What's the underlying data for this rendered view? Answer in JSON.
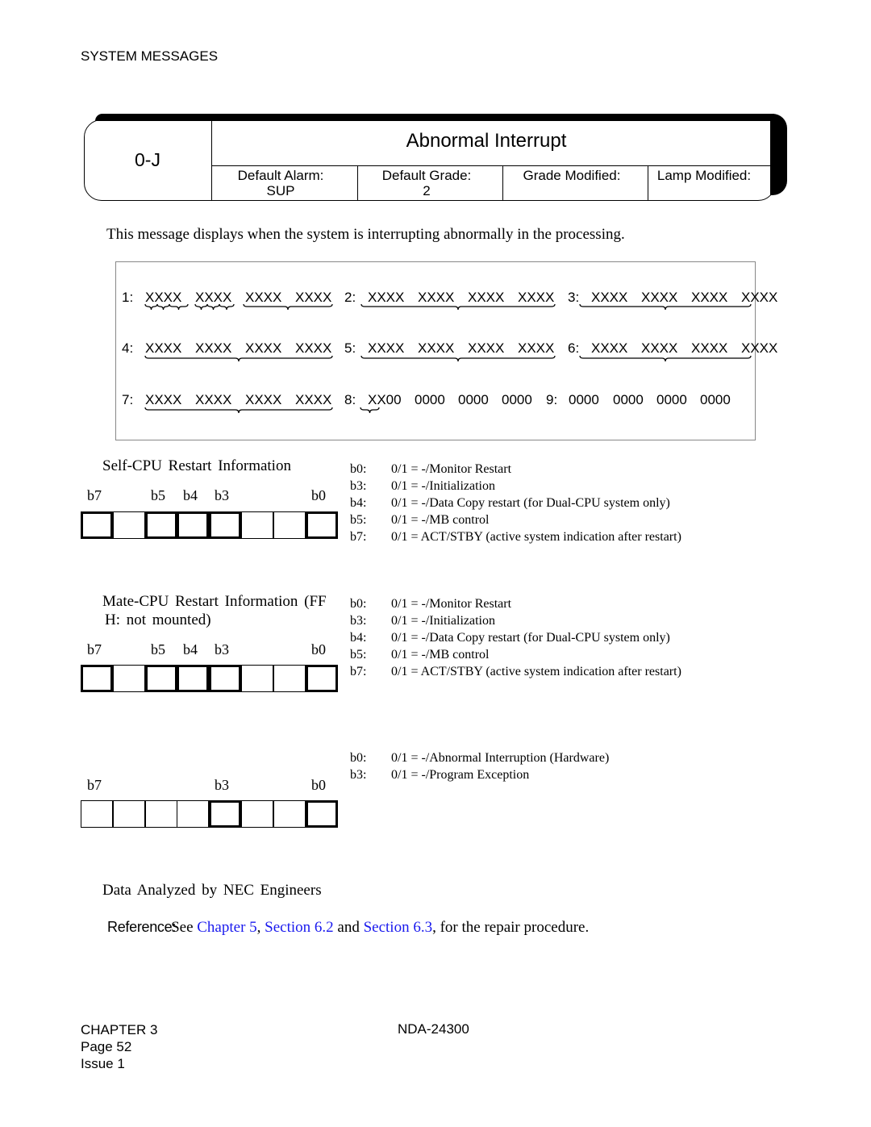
{
  "running_header": "SYSTEM MESSAGES",
  "header": {
    "code": "0-J",
    "title": "Abnormal Interrupt",
    "fields": [
      {
        "label": "Default Alarm:",
        "value": "SUP"
      },
      {
        "label": "Default Grade:",
        "value": "2"
      },
      {
        "label": "Grade Modified:",
        "value": ""
      },
      {
        "label": "Lamp Modified:",
        "value": ""
      }
    ]
  },
  "intro": "This message displays when the system is interrupting abnormally in the processing.",
  "data_lines": [
    [
      {
        "label": "1:",
        "words": [
          "XXXX",
          "XXXX",
          "XXXX",
          "XXXX"
        ]
      },
      {
        "label": "2:",
        "words": [
          "XXXX",
          "XXXX",
          "XXXX",
          "XXXX"
        ]
      },
      {
        "label": "3:",
        "words": [
          "XXXX",
          "XXXX",
          "XXXX",
          "XXXX"
        ]
      }
    ],
    [
      {
        "label": "4:",
        "words": [
          "XXXX",
          "XXXX",
          "XXXX",
          "XXXX"
        ]
      },
      {
        "label": "5:",
        "words": [
          "XXXX",
          "XXXX",
          "XXXX",
          "XXXX"
        ]
      },
      {
        "label": "6:",
        "words": [
          "XXXX",
          "XXXX",
          "XXXX",
          "XXXX"
        ]
      }
    ],
    [
      {
        "label": "7:",
        "words": [
          "XXXX",
          "XXXX",
          "XXXX",
          "XXXX"
        ]
      },
      {
        "label": "8:",
        "words": [
          "XX00",
          "0000",
          "0000",
          "0000"
        ]
      },
      {
        "label": "9:",
        "words": [
          "0000",
          "0000",
          "0000",
          "0000"
        ]
      }
    ]
  ],
  "sections": [
    {
      "title": "Self-CPU Restart Information",
      "bits": [
        "b7",
        "b5",
        "b4",
        "b3",
        "b0"
      ],
      "desc": [
        [
          "b0:",
          "0/1 = -/Monitor Restart"
        ],
        [
          "b3:",
          "0/1 = -/Initialization"
        ],
        [
          "b4:",
          "0/1 = -/Data Copy restart (for Dual-CPU system only)"
        ],
        [
          "b5:",
          "0/1 = -/MB control"
        ],
        [
          "b7:",
          "0/1 = ACT/STBY (active system indication after restart)"
        ]
      ]
    },
    {
      "title": "Mate-CPU Restart Information (FF",
      "title2": "H: not mounted)",
      "bits": [
        "b7",
        "b5",
        "b4",
        "b3",
        "b0"
      ],
      "desc": [
        [
          "b0:",
          "0/1 = -/Monitor Restart"
        ],
        [
          "b3:",
          "0/1 = -/Initialization"
        ],
        [
          "b4:",
          "0/1 = -/Data Copy restart (for Dual-CPU system only)"
        ],
        [
          "b5:",
          "0/1 = -/MB control"
        ],
        [
          "b7:",
          "0/1 = ACT/STBY (active system indication after restart)"
        ]
      ]
    },
    {
      "bits": [
        "b7",
        "b3",
        "b0"
      ],
      "desc": [
        [
          "b0:",
          "0/1 = -/Abnormal Interruption (Hardware)"
        ],
        [
          "b3:",
          "0/1 = -/Program Exception"
        ]
      ]
    }
  ],
  "analyzed": "Data Analyzed by NEC Engineers",
  "reference": {
    "label": "Reference:",
    "t1": "See ",
    "l1": "Chapter 5",
    "t2": ", ",
    "l2": "Section 6.2",
    "t3": " and ",
    "l3": "Section 6.3",
    "t4": ", for the repair procedure.",
    "link_color": "#1a1aee"
  },
  "footer": {
    "chapter": "CHAPTER 3",
    "page": "Page 52",
    "issue": "Issue 1",
    "doc": "NDA-24300"
  }
}
